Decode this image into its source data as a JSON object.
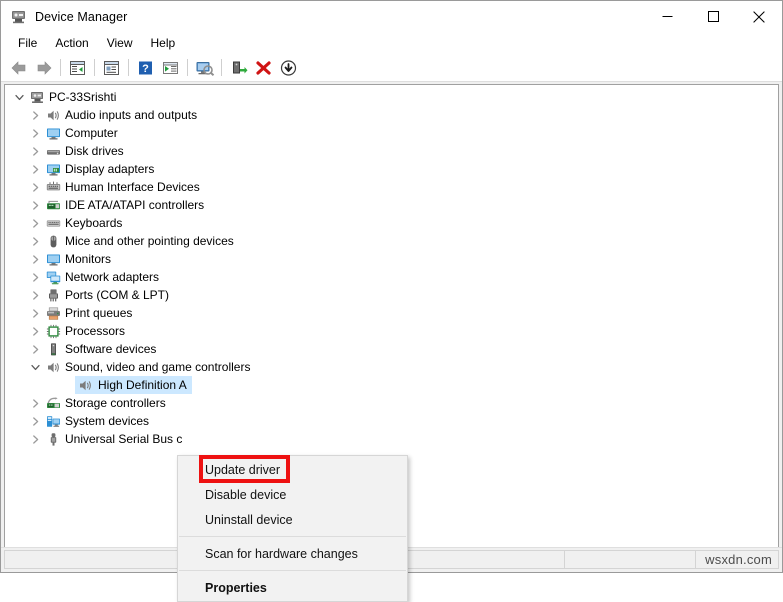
{
  "window": {
    "title": "Device Manager",
    "app_icon": "device-manager-icon",
    "controls": {
      "minimize": "minimize-icon",
      "maximize": "maximize-icon",
      "close": "close-icon"
    }
  },
  "menubar": {
    "items": [
      {
        "label": "File"
      },
      {
        "label": "Action"
      },
      {
        "label": "View"
      },
      {
        "label": "Help"
      }
    ]
  },
  "toolbar": {
    "buttons": [
      {
        "name": "back-icon",
        "type": "arrow-left"
      },
      {
        "name": "forward-icon",
        "type": "arrow-right"
      },
      {
        "name": "separator",
        "type": "sep"
      },
      {
        "name": "show-hide-console-tree-icon",
        "type": "tree"
      },
      {
        "name": "separator",
        "type": "sep"
      },
      {
        "name": "properties-icon",
        "type": "properties"
      },
      {
        "name": "separator",
        "type": "sep"
      },
      {
        "name": "help-icon",
        "type": "help"
      },
      {
        "name": "show-hide-action-pane-icon",
        "type": "actionpane"
      },
      {
        "name": "separator",
        "type": "sep"
      },
      {
        "name": "scan-for-hardware-changes-icon",
        "type": "scan"
      },
      {
        "name": "separator",
        "type": "sep"
      },
      {
        "name": "update-driver-icon",
        "type": "update"
      },
      {
        "name": "uninstall-device-icon",
        "type": "uninstall"
      },
      {
        "name": "disable-device-icon",
        "type": "disable"
      }
    ]
  },
  "tree": {
    "nodes": [
      {
        "label": "PC-33Srishti",
        "level": 0,
        "twisty": "expanded",
        "icon": "computer-node-icon",
        "selected": false
      },
      {
        "label": "Audio inputs and outputs",
        "level": 1,
        "twisty": "collapsed",
        "icon": "speaker-icon",
        "selected": false
      },
      {
        "label": "Computer",
        "level": 1,
        "twisty": "collapsed",
        "icon": "monitor-icon",
        "selected": false
      },
      {
        "label": "Disk drives",
        "level": 1,
        "twisty": "collapsed",
        "icon": "disk-drive-icon",
        "selected": false
      },
      {
        "label": "Display adapters",
        "level": 1,
        "twisty": "collapsed",
        "icon": "display-adapter-icon",
        "selected": false
      },
      {
        "label": "Human Interface Devices",
        "level": 1,
        "twisty": "collapsed",
        "icon": "hid-icon",
        "selected": false
      },
      {
        "label": "IDE ATA/ATAPI controllers",
        "level": 1,
        "twisty": "collapsed",
        "icon": "ide-controller-icon",
        "selected": false
      },
      {
        "label": "Keyboards",
        "level": 1,
        "twisty": "collapsed",
        "icon": "keyboard-icon",
        "selected": false
      },
      {
        "label": "Mice and other pointing devices",
        "level": 1,
        "twisty": "collapsed",
        "icon": "mouse-icon",
        "selected": false
      },
      {
        "label": "Monitors",
        "level": 1,
        "twisty": "collapsed",
        "icon": "monitor-icon",
        "selected": false
      },
      {
        "label": "Network adapters",
        "level": 1,
        "twisty": "collapsed",
        "icon": "network-adapter-icon",
        "selected": false
      },
      {
        "label": "Ports (COM & LPT)",
        "level": 1,
        "twisty": "collapsed",
        "icon": "port-icon",
        "selected": false
      },
      {
        "label": "Print queues",
        "level": 1,
        "twisty": "collapsed",
        "icon": "printer-icon",
        "selected": false
      },
      {
        "label": "Processors",
        "level": 1,
        "twisty": "collapsed",
        "icon": "processor-icon",
        "selected": false
      },
      {
        "label": "Software devices",
        "level": 1,
        "twisty": "collapsed",
        "icon": "software-device-icon",
        "selected": false
      },
      {
        "label": "Sound, video and game controllers",
        "level": 1,
        "twisty": "expanded",
        "icon": "speaker-icon",
        "selected": false
      },
      {
        "label": "High Definition A",
        "level": 2,
        "twisty": "none",
        "icon": "speaker-icon",
        "selected": true
      },
      {
        "label": "Storage controllers",
        "level": 1,
        "twisty": "collapsed",
        "icon": "storage-controller-icon",
        "selected": false
      },
      {
        "label": "System devices",
        "level": 1,
        "twisty": "collapsed",
        "icon": "system-device-icon",
        "selected": false
      },
      {
        "label": "Universal Serial Bus c",
        "level": 1,
        "twisty": "collapsed",
        "icon": "usb-icon",
        "selected": false
      }
    ]
  },
  "context_menu": {
    "items": [
      {
        "label": "Update driver",
        "bold": false,
        "separator_after": false,
        "highlighted": true
      },
      {
        "label": "Disable device",
        "bold": false,
        "separator_after": false,
        "highlighted": false
      },
      {
        "label": "Uninstall device",
        "bold": false,
        "separator_after": true,
        "highlighted": false
      },
      {
        "label": "Scan for hardware changes",
        "bold": false,
        "separator_after": true,
        "highlighted": false
      },
      {
        "label": "Properties",
        "bold": true,
        "separator_after": false,
        "highlighted": false
      }
    ],
    "highlight_color": "#ee1111"
  },
  "statusbar": {
    "panel1": "",
    "panel2": "",
    "watermark": "wsxdn.com"
  }
}
